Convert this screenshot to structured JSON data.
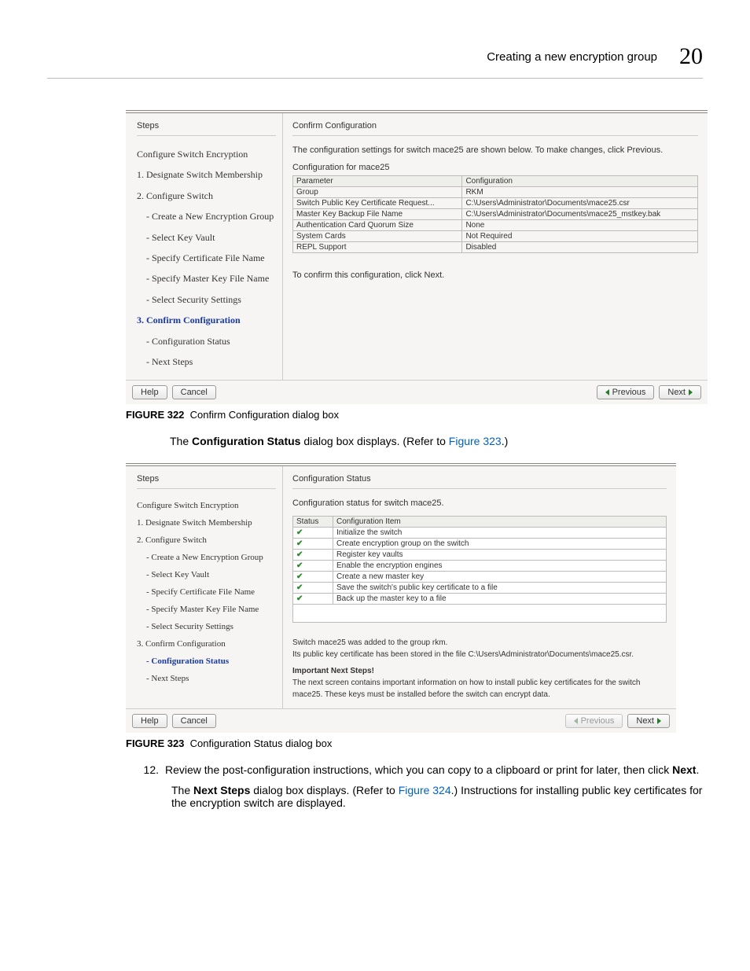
{
  "header": {
    "title": "Creating a new encryption group",
    "chapter": "20"
  },
  "figure322": {
    "caption_label": "FIGURE 322",
    "caption_text": "Confirm Configuration dialog box",
    "steps_header": "Steps",
    "right_header": "Confirm Configuration",
    "desc": "The configuration settings for switch mace25 are shown below. To make changes, click Previous.",
    "sub_header": "Configuration for mace25",
    "confirm_line": "To confirm this configuration, click Next.",
    "steps": {
      "top": "Configure Switch Encryption",
      "s1": "1. Designate Switch Membership",
      "s2": "2. Configure Switch",
      "s2a": "- Create a New Encryption Group",
      "s2b": "- Select Key Vault",
      "s2c": "- Specify Certificate File Name",
      "s2d": "- Specify Master Key File Name",
      "s2e": "- Select Security Settings",
      "s3": "3. Confirm Configuration",
      "s3a": "- Configuration Status",
      "s3b": "- Next Steps"
    },
    "table": {
      "h1": "Parameter",
      "h2": "Configuration",
      "r1c1": "Group",
      "r1c2": "RKM",
      "r2c1": "Switch Public Key Certificate Request...",
      "r2c2": "C:\\Users\\Administrator\\Documents\\mace25.csr",
      "r3c1": "Master Key Backup File Name",
      "r3c2": "C:\\Users\\Administrator\\Documents\\mace25_mstkey.bak",
      "r4c1": "Authentication Card Quorum Size",
      "r4c2": "None",
      "r5c1": "System Cards",
      "r5c2": "Not Required",
      "r6c1": "REPL Support",
      "r6c2": "Disabled"
    },
    "buttons": {
      "help": "Help",
      "cancel": "Cancel",
      "previous": "Previous",
      "next": "Next"
    }
  },
  "mid_text": {
    "prefix": "The ",
    "bold": "Configuration Status",
    "after": " dialog box displays. (Refer to ",
    "link": "Figure 323",
    "end": ".)"
  },
  "figure323": {
    "caption_label": "FIGURE 323",
    "caption_text": "Configuration Status dialog box",
    "steps_header": "Steps",
    "right_header": "Configuration Status",
    "desc": "Configuration status for switch mace25.",
    "steps": {
      "top": "Configure Switch Encryption",
      "s1": "1. Designate Switch Membership",
      "s2": "2. Configure Switch",
      "s2a": "- Create a New Encryption Group",
      "s2b": "- Select Key Vault",
      "s2c": "- Specify Certificate File Name",
      "s2d": "- Specify Master Key File Name",
      "s2e": "- Select Security Settings",
      "s3": "3. Confirm Configuration",
      "s3a": "- Configuration Status",
      "s3b": "- Next Steps"
    },
    "status": {
      "h1": "Status",
      "h2": "Configuration Item",
      "i1": "Initialize the switch",
      "i2": "Create encryption group on the switch",
      "i3": "Register key vaults",
      "i4": "Enable the encryption engines",
      "i5": "Create a new master key",
      "i6": "Save the switch's public key certificate to a file",
      "i7": "Back up the master key to a file"
    },
    "msg": {
      "l1": "Switch mace25 was added to the group rkm.",
      "l2": "Its public key certificate has been stored in the file C:\\Users\\Administrator\\Documents\\mace25.csr.",
      "l3": "Important Next Steps!",
      "l4": "The next screen contains important information on how to install public key certificates for the switch mace25. These keys must be installed before the switch can encrypt data."
    },
    "buttons": {
      "help": "Help",
      "cancel": "Cancel",
      "previous": "Previous",
      "next": "Next"
    }
  },
  "step12": {
    "num": "12.",
    "l1a": "Review the post-configuration instructions, which you can copy to a clipboard or print for later, then click ",
    "l1b": "Next",
    "l1c": ".",
    "l2a": "The ",
    "l2b": "Next Steps",
    "l2c": " dialog box displays. (Refer to ",
    "l2link": "Figure 324",
    "l2d": ".) Instructions for installing public key certificates for the encryption switch are displayed."
  }
}
